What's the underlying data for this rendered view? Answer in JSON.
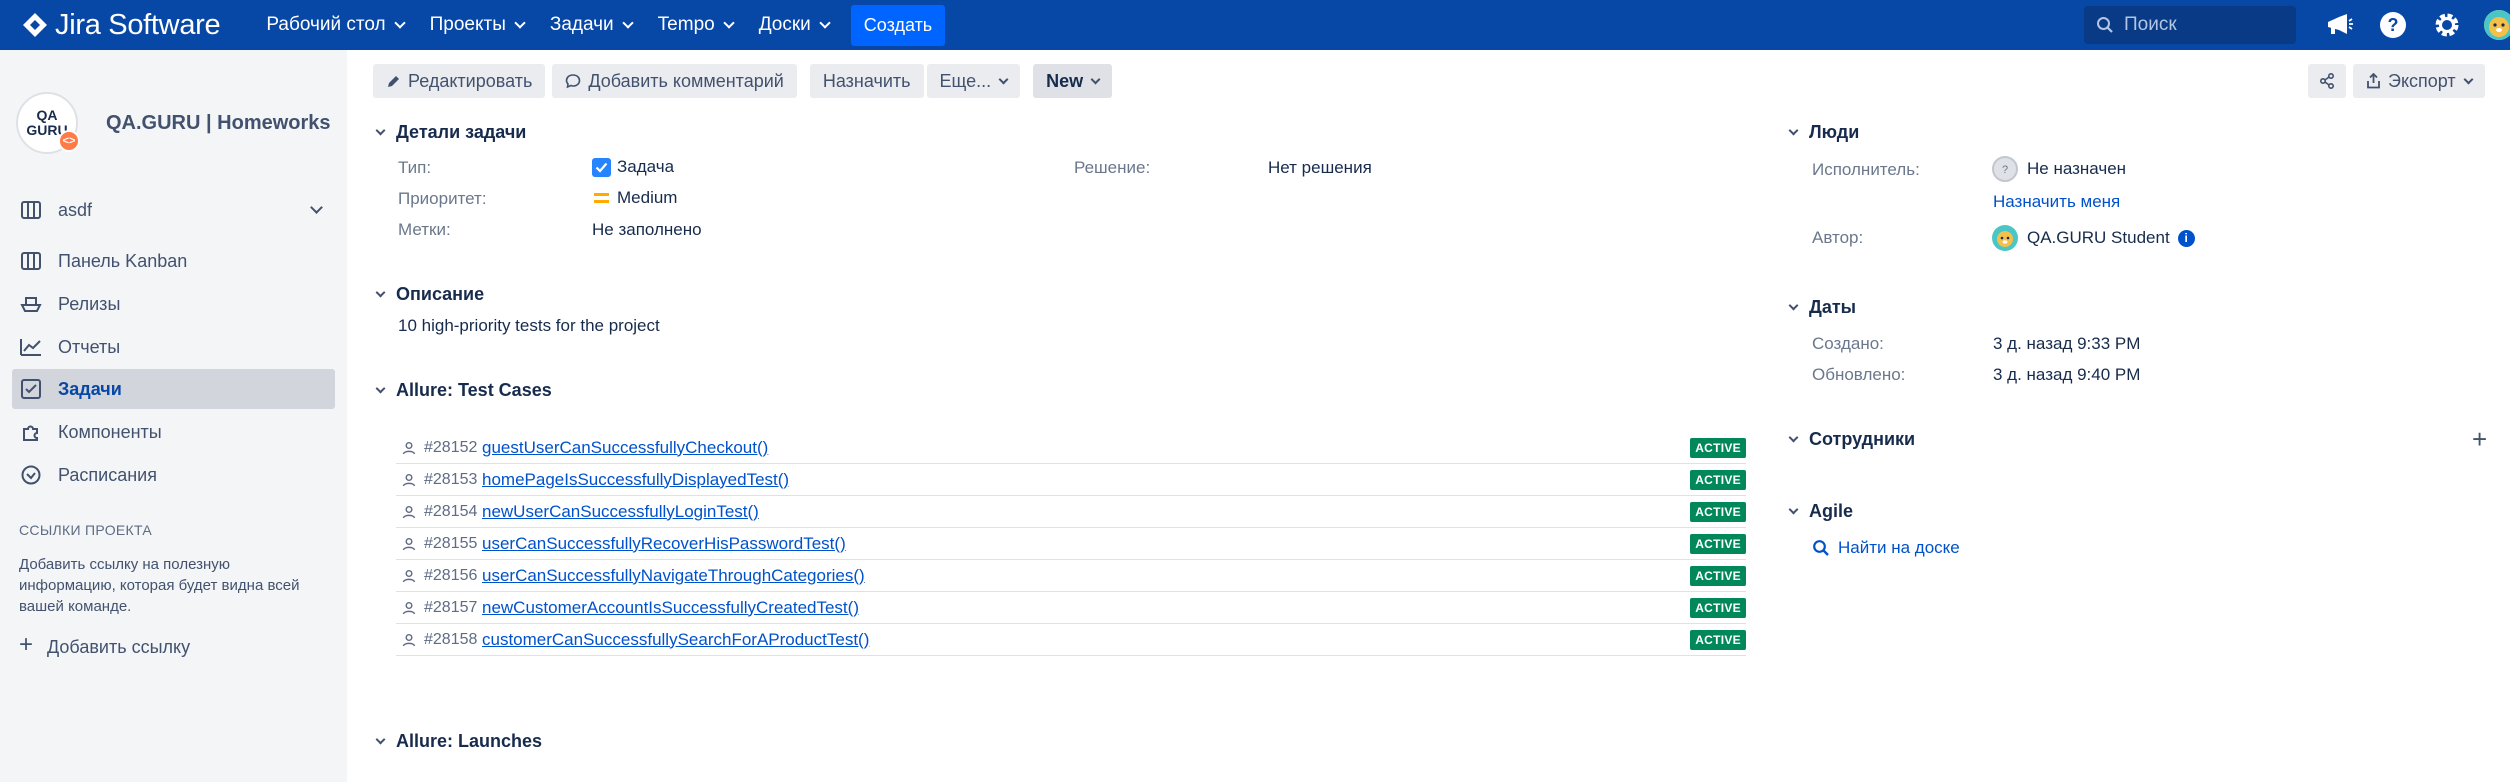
{
  "topbar": {
    "product": "Jira Software",
    "nav": [
      {
        "label": "Рабочий стол"
      },
      {
        "label": "Проекты"
      },
      {
        "label": "Задачи"
      },
      {
        "label": "Tempo"
      },
      {
        "label": "Доски"
      }
    ],
    "create": "Создать",
    "search_placeholder": "Поиск",
    "colors": {
      "bar": "#0747a6",
      "create": "#0065ff"
    }
  },
  "sidebar": {
    "project_name": "QA.GURU | Homeworks",
    "project_avatar_text": "QA GURU",
    "board": "asdf",
    "items": [
      {
        "label": "Панель Kanban",
        "icon": "board-icon"
      },
      {
        "label": "Релизы",
        "icon": "ship-icon"
      },
      {
        "label": "Отчеты",
        "icon": "chart-icon"
      },
      {
        "label": "Задачи",
        "icon": "issues-icon",
        "active": true
      },
      {
        "label": "Компоненты",
        "icon": "puzzle-icon"
      },
      {
        "label": "Расписания",
        "icon": "clock-icon"
      }
    ],
    "links_section": "ССЫЛКИ ПРОЕКТА",
    "links_help": "Добавить ссылку на полезную информацию, которая будет видна всей вашей команде.",
    "add_link": "Добавить ссылку"
  },
  "toolbar": {
    "edit": "Редактировать",
    "comment": "Добавить комментарий",
    "assign": "Назначить",
    "more": "Еще...",
    "status": "New",
    "export": "Экспорт"
  },
  "details": {
    "title": "Детали задачи",
    "type_label": "Тип:",
    "type_value": "Задача",
    "priority_label": "Приоритет:",
    "priority_value": "Medium",
    "labels_label": "Метки:",
    "labels_value": "Не заполнено",
    "resolution_label": "Решение:",
    "resolution_value": "Нет решения"
  },
  "description": {
    "title": "Описание",
    "text": "10 high-priority tests for the project"
  },
  "allure_test_cases": {
    "title": "Allure: Test Cases",
    "rows": [
      {
        "id": "#28152",
        "name": "guestUserCanSuccessfullyCheckout()",
        "status": "ACTIVE"
      },
      {
        "id": "#28153",
        "name": "homePageIsSuccessfullyDisplayedTest()",
        "status": "ACTIVE"
      },
      {
        "id": "#28154",
        "name": "newUserCanSuccessfullyLoginTest()",
        "status": "ACTIVE"
      },
      {
        "id": "#28155",
        "name": "userCanSuccessfullyRecoverHisPasswordTest()",
        "status": "ACTIVE"
      },
      {
        "id": "#28156",
        "name": "userCanSuccessfullyNavigateThroughCategories()",
        "status": "ACTIVE"
      },
      {
        "id": "#28157",
        "name": "newCustomerAccountIsSuccessfullyCreatedTest()",
        "status": "ACTIVE"
      },
      {
        "id": "#28158",
        "name": "customerCanSuccessfullySearchForAProductTest()",
        "status": "ACTIVE"
      }
    ]
  },
  "allure_launches": {
    "title": "Allure: Launches"
  },
  "people": {
    "title": "Люди",
    "assignee_label": "Исполнитель:",
    "assignee_value": "Не назначен",
    "assign_me": "Назначить меня",
    "reporter_label": "Автор:",
    "reporter_value": "QA.GURU Student"
  },
  "dates": {
    "title": "Даты",
    "created_label": "Создано:",
    "created_value": "3 д. назад 9:33 PM",
    "updated_label": "Обновлено:",
    "updated_value": "3 д. назад 9:40 PM"
  },
  "employees": {
    "title": "Сотрудники"
  },
  "agile": {
    "title": "Agile",
    "find_on_board": "Найти на доске"
  }
}
